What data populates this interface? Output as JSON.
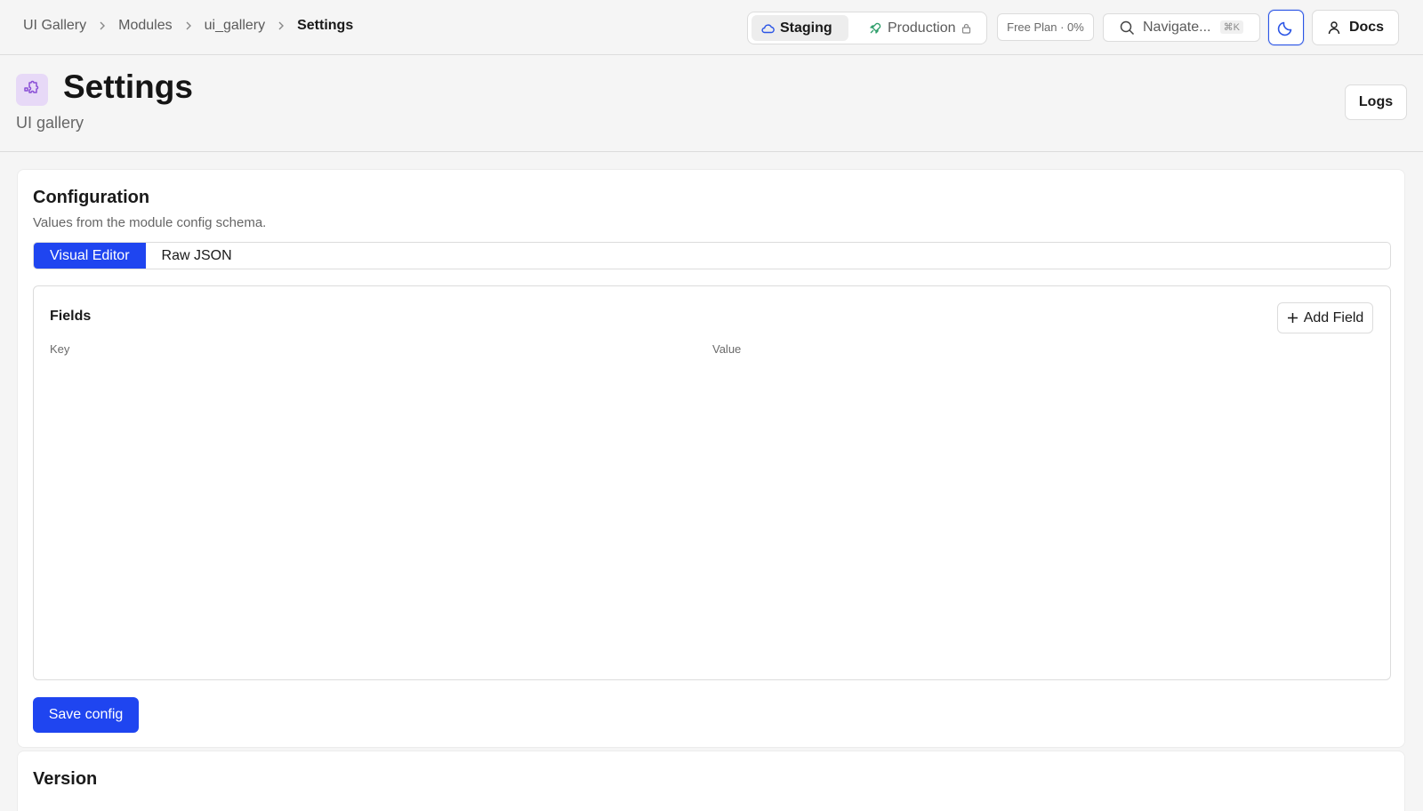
{
  "breadcrumb": {
    "items": [
      "UI Gallery",
      "Modules",
      "ui_gallery"
    ],
    "current": "Settings"
  },
  "env": {
    "staging_label": "Staging",
    "production_label": "Production"
  },
  "plan": {
    "label": "Free Plan · 0%"
  },
  "navigate": {
    "placeholder": "Navigate...",
    "shortcut": "⌘K"
  },
  "header_actions": {
    "docs_label": "Docs"
  },
  "page": {
    "title": "Settings",
    "subtitle": "UI gallery",
    "logs_label": "Logs"
  },
  "configuration": {
    "title": "Configuration",
    "description": "Values from the module config schema.",
    "tabs": [
      "Visual Editor",
      "Raw JSON"
    ],
    "active_tab": "Visual Editor",
    "fields_title": "Fields",
    "add_field_label": "Add Field",
    "columns": {
      "key": "Key",
      "value": "Value"
    },
    "save_label": "Save config"
  },
  "version": {
    "title": "Version"
  },
  "colors": {
    "accent": "#1f45f0",
    "module_icon_bg": "#e7d9f7",
    "module_icon_fg": "#8a4fd6",
    "production_icon": "#2e9e6a"
  },
  "icons": {
    "breadcrumb_separator": "chevron-right-icon",
    "staging": "cloud-icon",
    "production": "rocket-icon",
    "production_lock": "lock-icon",
    "navigate": "search-icon",
    "theme": "moon-icon",
    "docs": "user-icon",
    "module": "puzzle-icon",
    "add_field": "plus-icon"
  }
}
